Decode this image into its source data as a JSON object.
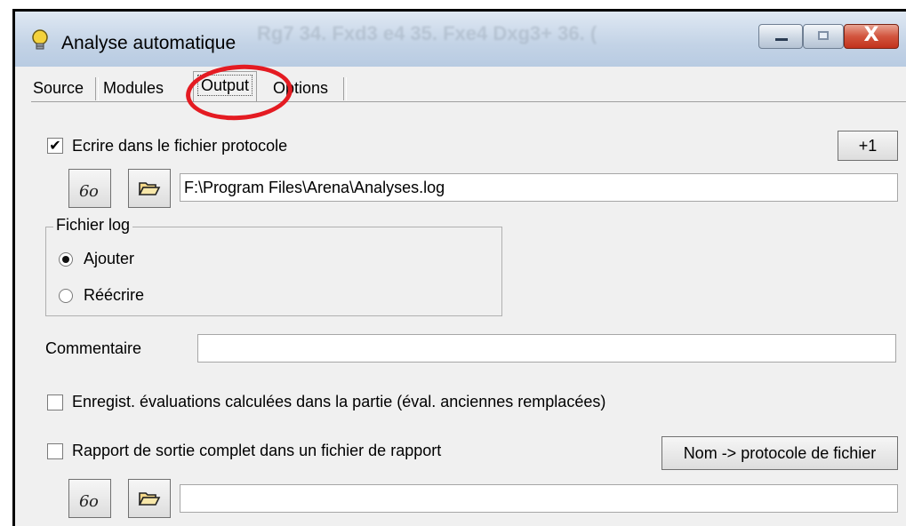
{
  "window": {
    "title": "Analyse automatique",
    "background_ghost_text": "Rg7 34. Fxd3 e4 35. Fxe4 Dxg3+ 36. (",
    "close_glyph": "X"
  },
  "tabs": [
    {
      "label": "Source"
    },
    {
      "label": "Modules"
    },
    {
      "label": "Output",
      "active": true
    },
    {
      "label": "Options"
    }
  ],
  "output": {
    "write_protocol": {
      "label": "Ecrire dans le fichier protocole",
      "checked": true,
      "check_glyph": "✔"
    },
    "plus_one_button": "+1",
    "protocol_path": "F:\\Program Files\\Arena\\Analyses.log",
    "log_file_group": {
      "title": "Fichier log",
      "options": [
        {
          "label": "Ajouter",
          "selected": true
        },
        {
          "label": "Réécrire",
          "selected": false
        }
      ]
    },
    "comment": {
      "label": "Commentaire",
      "value": ""
    },
    "save_evaluations": {
      "label": "Enregist. évaluations calculées dans la partie (éval. anciennes remplacées)",
      "checked": false
    },
    "full_report": {
      "label": "Rapport de sortie complet dans un fichier de rapport",
      "checked": false
    },
    "name_button": "Nom -> protocole de fichier",
    "report_path": ""
  },
  "icons": {
    "view": "glasses-icon",
    "open": "folder-open-icon",
    "app": "lightbulb-icon"
  },
  "colors": {
    "annotation_circle": "#e41b22",
    "dialog_background": "#f0f0f0",
    "close_button": "#c2321c"
  }
}
